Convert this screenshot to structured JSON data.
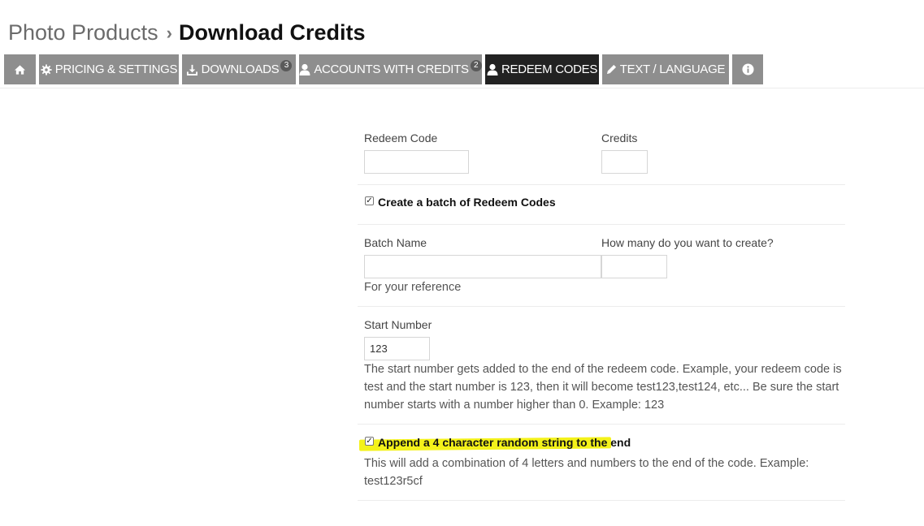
{
  "breadcrumb": {
    "parent": "Photo Products",
    "separator": "›",
    "current": "Download Credits"
  },
  "tabs": [
    {
      "icon": "home-icon",
      "label": "",
      "badge": ""
    },
    {
      "icon": "gear-icon",
      "label": "PRICING & SETTINGS",
      "badge": ""
    },
    {
      "icon": "download-icon",
      "label": "DOWNLOADS",
      "badge": "3"
    },
    {
      "icon": "user-icon",
      "label": "ACCOUNTS WITH CREDITS",
      "badge": "2"
    },
    {
      "icon": "user-icon",
      "label": "REDEEM CODES",
      "badge": "",
      "active": true
    },
    {
      "icon": "pencil-icon",
      "label": "TEXT / LANGUAGE",
      "badge": ""
    },
    {
      "icon": "info-icon",
      "label": "",
      "badge": ""
    }
  ],
  "form": {
    "redeem_code_label": "Redeem Code",
    "redeem_code_value": "",
    "credits_label": "Credits",
    "credits_value": "",
    "batch_checkbox_label": "Create a batch of Redeem Codes",
    "batch_checked": true,
    "batch_name_label": "Batch Name",
    "batch_name_value": "",
    "batch_name_help": "For your reference",
    "how_many_label": "How many do you want to create?",
    "how_many_value": "",
    "start_number_label": "Start Number",
    "start_number_value": "123",
    "start_number_help": "The start number gets added to the end of the redeem code. Example, your redeem code is test and the start number is 123, then it will become test123,test124, etc... Be sure the start number starts with a number higher than 0. Example: 123",
    "append_checkbox_label": "Append a 4 character random string to the end",
    "append_checked": true,
    "append_help": "This will add a combination of 4 letters and numbers to the end of the code. Example: test123r5cf"
  },
  "colors": {
    "tab_bg": "#8e8e8e",
    "tab_active_bg": "#222222",
    "highlight": "#f4f21a"
  }
}
